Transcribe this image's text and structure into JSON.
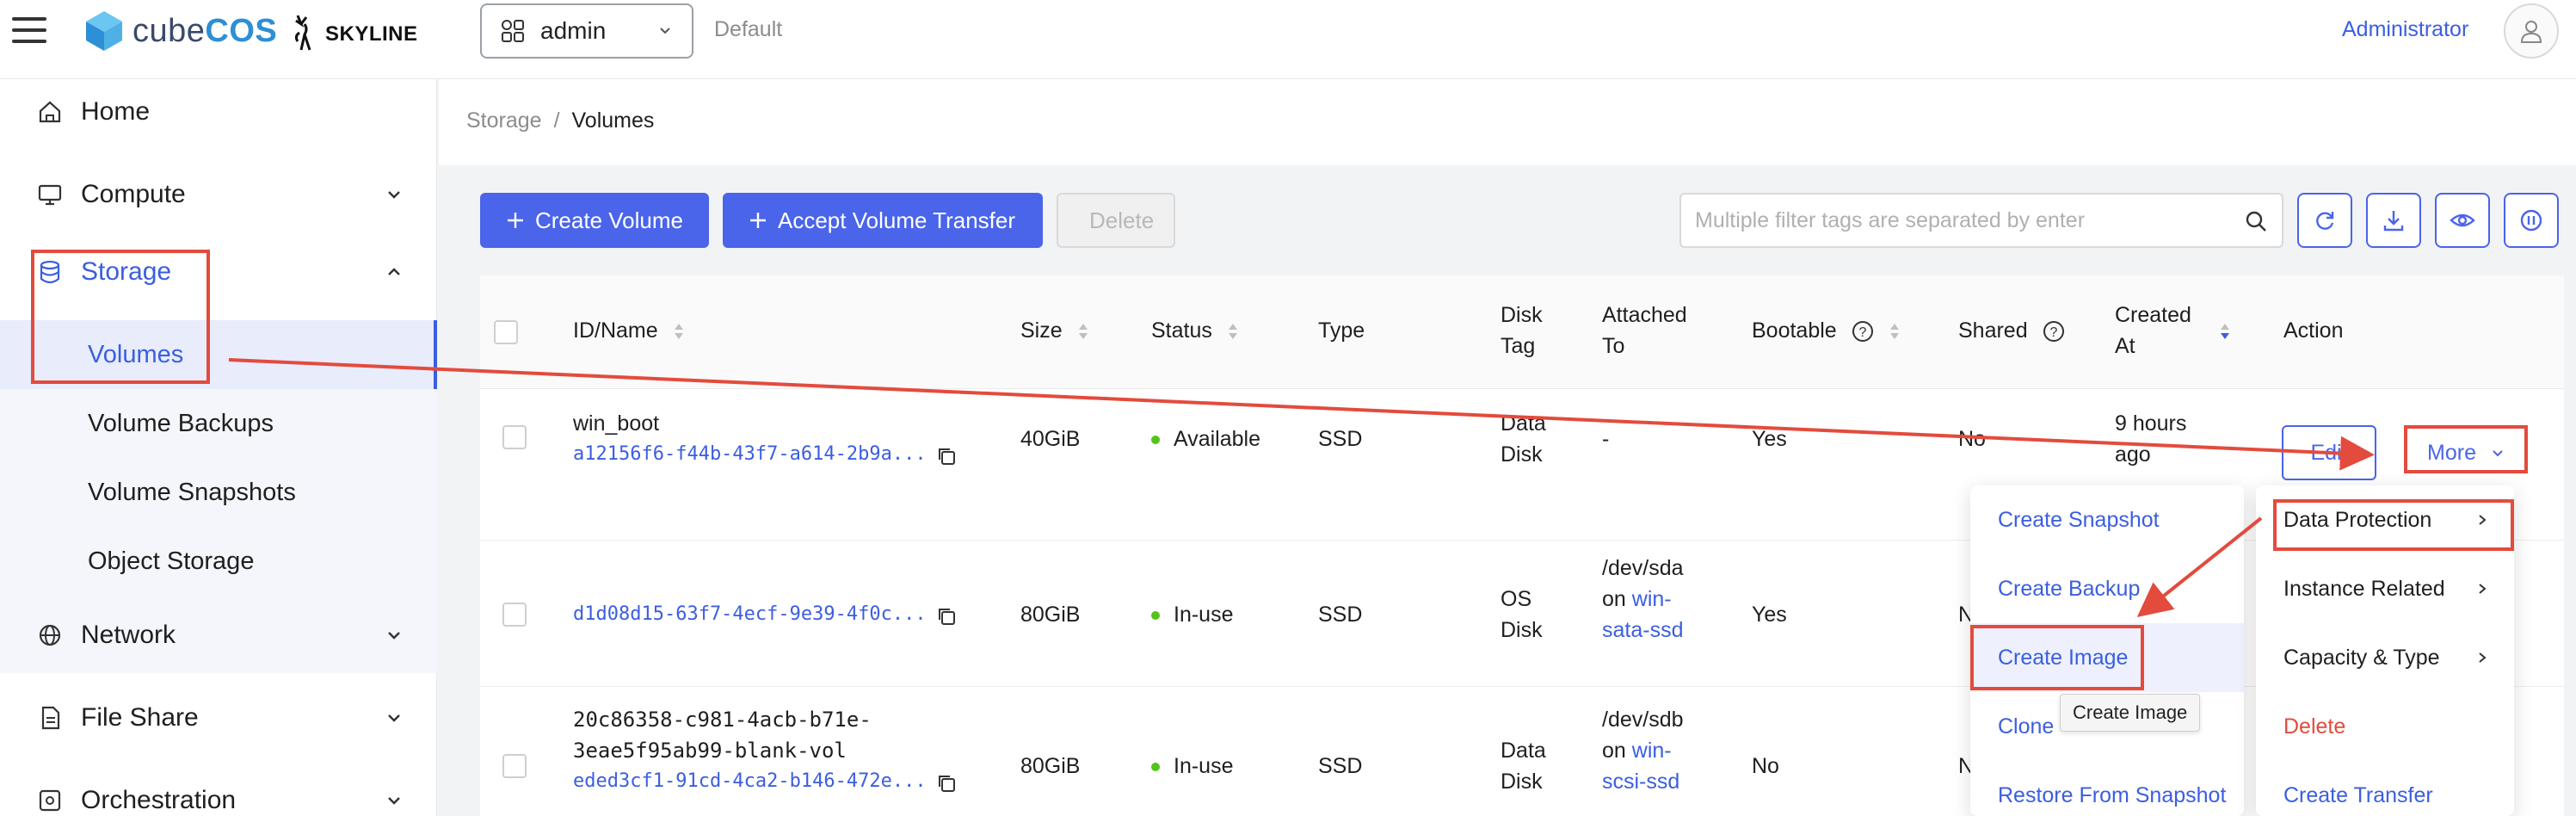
{
  "header": {
    "logo_prefix": "cube",
    "logo_suffix": "COS",
    "partner_logo": "SKYLINE",
    "project": "admin",
    "domain": "Default",
    "user": "Administrator"
  },
  "sidebar": {
    "items": [
      {
        "label": "Home",
        "icon": "home-icon"
      },
      {
        "label": "Compute",
        "icon": "monitor-icon"
      },
      {
        "label": "Storage",
        "icon": "database-icon"
      },
      {
        "label": "Network",
        "icon": "globe-icon"
      },
      {
        "label": "File Share",
        "icon": "file-icon"
      },
      {
        "label": "Orchestration",
        "icon": "orchestration-icon"
      }
    ],
    "storage_sub": [
      {
        "label": "Volumes"
      },
      {
        "label": "Volume Backups"
      },
      {
        "label": "Volume Snapshots"
      },
      {
        "label": "Object Storage"
      }
    ]
  },
  "breadcrumb": {
    "parent": "Storage",
    "sep": "/",
    "current": "Volumes"
  },
  "toolbar": {
    "create_volume": "Create Volume",
    "accept_transfer": "Accept Volume Transfer",
    "delete": "Delete",
    "search_placeholder": "Multiple filter tags are separated by enter"
  },
  "table": {
    "headers": {
      "id_name": "ID/Name",
      "size": "Size",
      "status": "Status",
      "type": "Type",
      "disk_tag_1": "Disk",
      "disk_tag_2": "Tag",
      "attached_1": "Attached",
      "attached_2": "To",
      "bootable": "Bootable",
      "shared": "Shared",
      "created_1": "Created",
      "created_2": "At",
      "action": "Action"
    },
    "rows": [
      {
        "name": "win_boot",
        "id": "a12156f6-f44b-43f7-a614-2b9a...",
        "size": "40GiB",
        "status": "Available",
        "type": "SSD",
        "disk_tag_1": "Data",
        "disk_tag_2": "Disk",
        "attached": "-",
        "bootable": "Yes",
        "shared": "No",
        "created_1": "9 hours",
        "created_2": "ago"
      },
      {
        "id": "d1d08d15-63f7-4ecf-9e39-4f0c...",
        "size": "80GiB",
        "status": "In-use",
        "type": "SSD",
        "disk_tag_1": "OS",
        "disk_tag_2": "Disk",
        "attached_1": "/dev/sda",
        "attached_2": "on",
        "attached_link_1": "win-",
        "attached_link_2": "sata-ssd",
        "bootable": "Yes",
        "shared": "N"
      },
      {
        "name_1": "20c86358-c981-4acb-b71e-",
        "name_2": "3eae5f95ab99-blank-vol",
        "id": "eded3cf1-91cd-4ca2-b146-472e...",
        "size": "80GiB",
        "status": "In-use",
        "type": "SSD",
        "disk_tag_1": "Data",
        "disk_tag_2": "Disk",
        "attached_1": "/dev/sdb",
        "attached_2": "on",
        "attached_link_1": "win-",
        "attached_link_2": "scsi-ssd",
        "bootable": "No",
        "shared": "N"
      }
    ],
    "edit": "Edit",
    "more": "More"
  },
  "more_menu": {
    "left": [
      "Create Snapshot",
      "Create Backup",
      "Create Image",
      "Clone",
      "Restore From Snapshot"
    ],
    "right": [
      "Data Protection",
      "Instance Related",
      "Capacity & Type",
      "Delete",
      "Create Transfer"
    ],
    "tooltip": "Create Image"
  },
  "colors": {
    "primary": "#4a64ea",
    "annotation_red": "#e34b3d",
    "status_green": "#52c41a"
  }
}
